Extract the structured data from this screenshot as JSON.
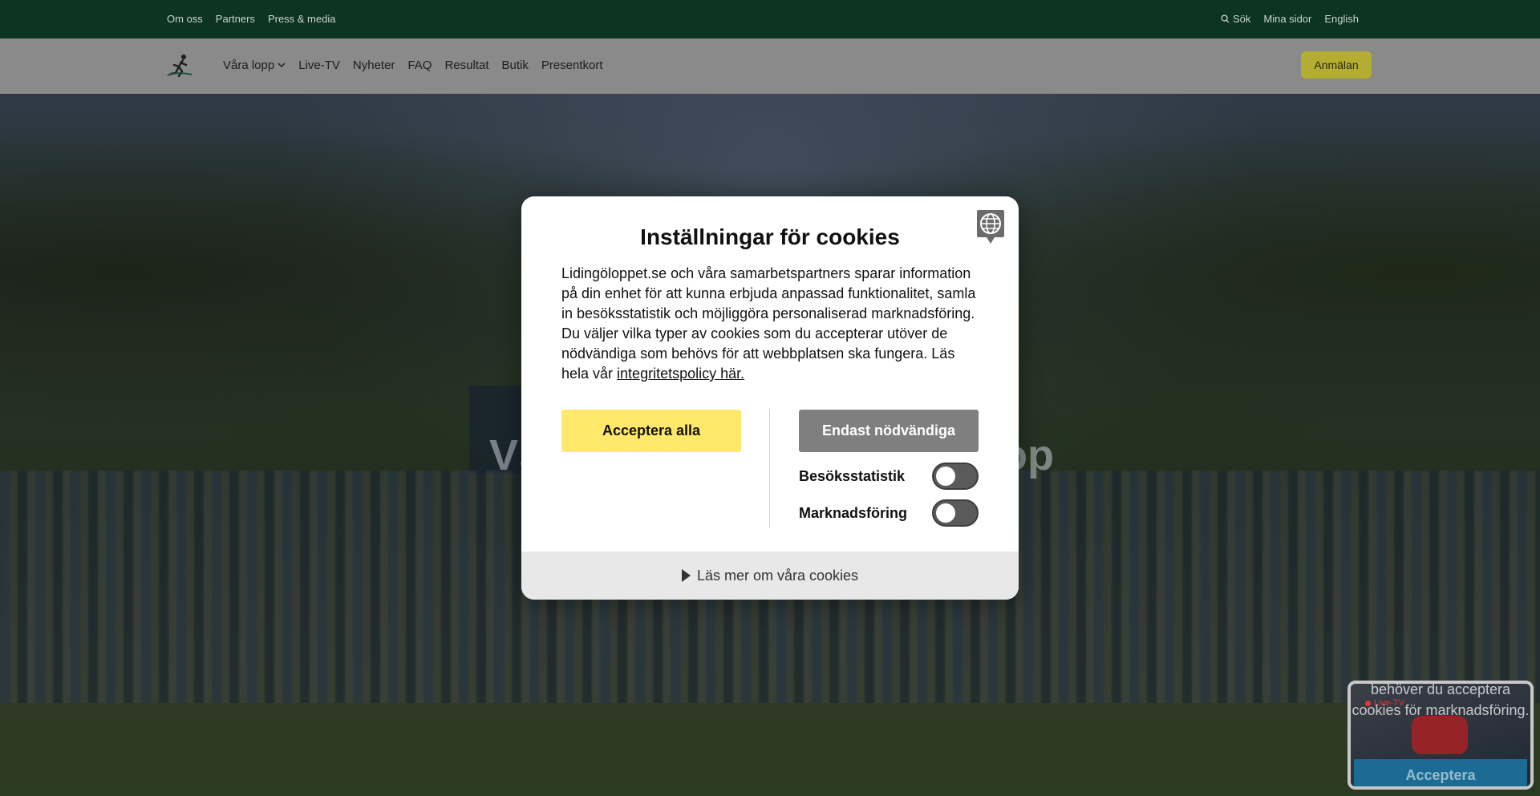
{
  "topbar": {
    "links": [
      "Om oss",
      "Partners",
      "Press & media"
    ],
    "search_label": "Sök",
    "my_pages": "Mina sidor",
    "language": "English"
  },
  "nav": {
    "items": [
      "Våra lopp",
      "Live-TV",
      "Nyheter",
      "FAQ",
      "Resultat",
      "Butik",
      "Presentkort"
    ],
    "signup_label": "Anmälan"
  },
  "hero": {
    "text_left": "Vä",
    "text_right": "op"
  },
  "cookie_modal": {
    "title": "Inställningar för cookies",
    "body": "Lidingöloppet.se och våra samarbetspartners sparar information på din enhet för att kunna erbjuda anpassad funktionalitet, samla in besöksstatistik och möjliggöra personaliserad marknadsföring. Du väljer vilka typer av cookies som du accepterar utöver de nödvändiga som behövs för att webbplatsen ska fungera. Läs hela vår ",
    "policy_link": "integritetspolicy här.",
    "accept_all": "Acceptera alla",
    "only_necessary": "Endast nödvändiga",
    "toggles": [
      {
        "label": "Besöksstatistik",
        "enabled": false
      },
      {
        "label": "Marknadsföring",
        "enabled": false
      }
    ],
    "read_more": "Läs mer om våra cookies"
  },
  "live_widget": {
    "badge": "Live-TV",
    "message": "behöver du acceptera cookies för marknadsföring.",
    "accept_label": "Acceptera"
  },
  "colors": {
    "topbar_bg": "#0d3322",
    "accept_yellow": "#ffe86a",
    "necessary_gray": "#7f7f7f",
    "signup_yellow": "#b5ad32"
  }
}
